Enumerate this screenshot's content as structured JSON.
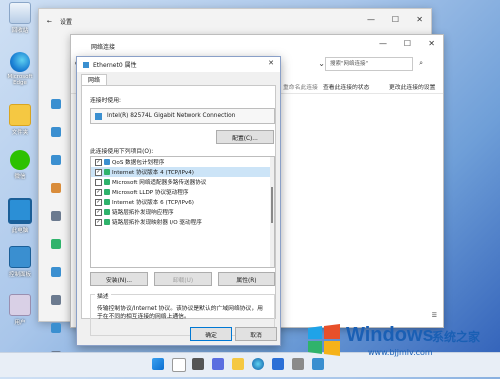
{
  "desktop": {
    "icons": [
      {
        "name": "recycle-bin",
        "label": "回收站"
      },
      {
        "name": "edge",
        "label": "Microsoft Edge"
      },
      {
        "name": "folder",
        "label": "文件夹"
      },
      {
        "name": "wechat",
        "label": "微信"
      },
      {
        "name": "this-pc",
        "label": "此电脑"
      },
      {
        "name": "control-panel",
        "label": "控制面板"
      },
      {
        "name": "user",
        "label": "用户"
      }
    ]
  },
  "settings_window": {
    "title": "设置"
  },
  "netconn_window": {
    "title": "网络连接",
    "search_placeholder": "搜索\"网络连接\"",
    "cmd_rename": "重命名此连接",
    "cmd_view_status": "查看此连接的状态",
    "cmd_change_settings": "更改此连接的设置"
  },
  "properties_dialog": {
    "title": "Ethernet0 属性",
    "tab": "网络",
    "connect_using_label": "连接时使用:",
    "adapter": "Intel(R) 82574L Gigabit Network Connection",
    "configure_button": "配置(C)...",
    "items_label": "此连接使用下列项目(O):",
    "items": [
      {
        "checked": true,
        "text": "QoS 数据包计划程序",
        "selected": false
      },
      {
        "checked": true,
        "text": "Internet 协议版本 4 (TCP/IPv4)",
        "selected": true
      },
      {
        "checked": false,
        "text": "Microsoft 网络适配器多路传送器协议",
        "selected": false
      },
      {
        "checked": true,
        "text": "Microsoft LLDP 协议驱动程序",
        "selected": false
      },
      {
        "checked": true,
        "text": "Internet 协议版本 6 (TCP/IPv6)",
        "selected": false
      },
      {
        "checked": true,
        "text": "链路层拓扑发现响应程序",
        "selected": false
      },
      {
        "checked": true,
        "text": "链路层拓扑发现映射器 I/O 驱动程序",
        "selected": false
      }
    ],
    "install_button": "安装(N)...",
    "uninstall_button": "卸载(U)",
    "properties_button": "属性(R)",
    "description_label": "描述",
    "description_text": "传输控制协议/Internet 协议。该协议是默认的广域网络协议，用于在不同的相互连接的网络上通信。",
    "ok_button": "确定",
    "cancel_button": "取消"
  },
  "watermark": {
    "brand": "Windows",
    "suffix": "系统之家",
    "url": "www.bjjmlv.com"
  },
  "colors": {
    "accent": "#0078d4",
    "watermark_blue": "#1a5fb4"
  }
}
